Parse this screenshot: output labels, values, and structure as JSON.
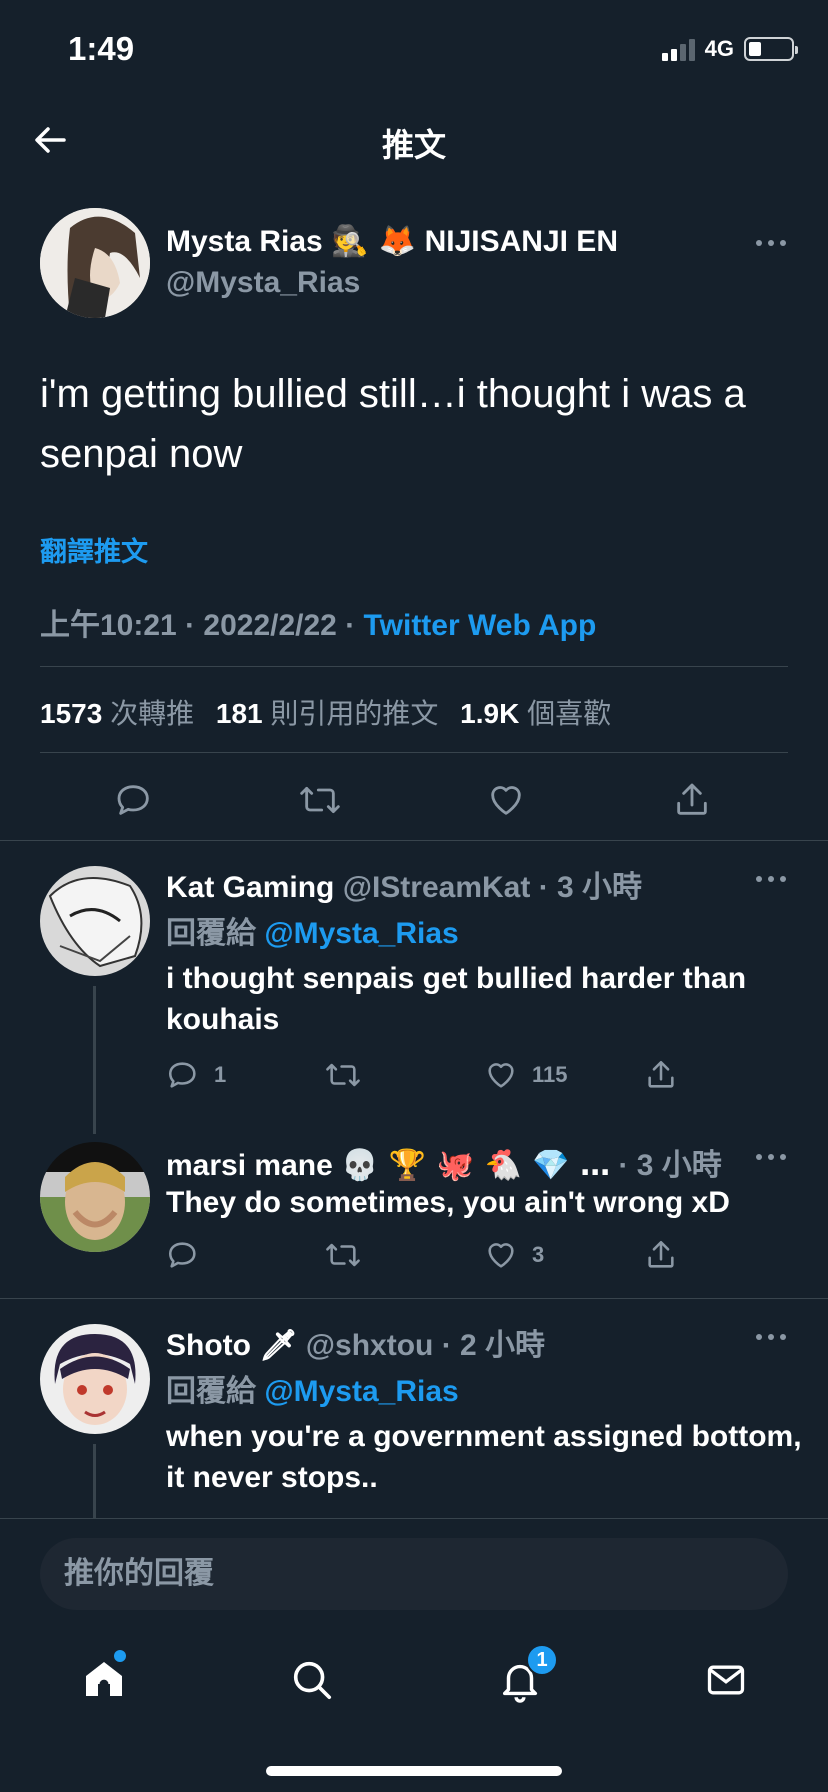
{
  "status_bar": {
    "time": "1:49",
    "network": "4G"
  },
  "nav": {
    "title": "推文"
  },
  "main_tweet": {
    "name": "Mysta Rias",
    "name_emojis": "🕵 🦊",
    "name_suffix": "NIJISANJI EN",
    "handle": "@Mysta_Rias",
    "text": "i'm getting bullied still…i thought i was a senpai now",
    "translate_label": "翻譯推文",
    "time": "上午10:21",
    "date": "2022/2/22",
    "source": "Twitter Web App",
    "retweets_count": "1573",
    "retweets_label": "次轉推",
    "quotes_count": "181",
    "quotes_label": "則引用的推文",
    "likes_count": "1.9K",
    "likes_label": "個喜歡"
  },
  "replies": [
    {
      "name": "Kat Gaming",
      "handle": "@IStreamKat",
      "time": "3 小時",
      "reply_label": "回覆給",
      "reply_to": "@Mysta_Rias",
      "text": "i thought senpais get bullied harder than kouhais",
      "reply_count": "1",
      "like_count": "115"
    },
    {
      "name": "marsi mane",
      "name_emojis": "💀 🏆 🐙 🐔 💎 …",
      "time": "3 小時",
      "text": "They do sometimes, you ain't wrong xD",
      "like_count": "3"
    },
    {
      "name": "Shoto",
      "name_emojis": "🗡",
      "handle": "@shxtou",
      "time": "2 小時",
      "reply_label": "回覆給",
      "reply_to": "@Mysta_Rias",
      "text": "when you're a government assigned bottom, it never stops.."
    }
  ],
  "compose": {
    "placeholder": "推你的回覆"
  },
  "tabbar": {
    "notification_badge": "1"
  },
  "colors": {
    "background": "#15202b",
    "accent": "#1d9bf0",
    "secondary_text": "#8b98a5",
    "divider": "#38444d"
  }
}
